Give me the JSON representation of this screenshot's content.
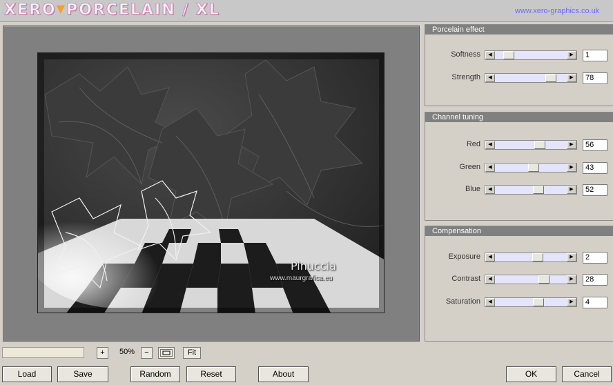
{
  "app": {
    "logo_text_1": "XERO",
    "logo_text_2": "PORCELAIN / XL",
    "url": "www.xero-graphics.co.uk"
  },
  "preview": {
    "artist_signature": "Pinuccia",
    "artist_url": "www.maurgrafica.eu"
  },
  "panels": [
    {
      "title": "Porcelain effect",
      "sliders": [
        {
          "label": "Softness",
          "value": "1",
          "fraction": 0.12
        },
        {
          "label": "Strength",
          "value": "78",
          "fraction": 0.85
        }
      ]
    },
    {
      "title": "Channel tuning",
      "sliders": [
        {
          "label": "Red",
          "value": "56",
          "fraction": 0.66
        },
        {
          "label": "Green",
          "value": "43",
          "fraction": 0.55
        },
        {
          "label": "Blue",
          "value": "52",
          "fraction": 0.63
        }
      ]
    },
    {
      "title": "Compensation",
      "sliders": [
        {
          "label": "Exposure",
          "value": "2",
          "fraction": 0.62
        },
        {
          "label": "Contrast",
          "value": "28",
          "fraction": 0.73
        },
        {
          "label": "Saturation",
          "value": "4",
          "fraction": 0.63
        }
      ]
    }
  ],
  "zoom": {
    "plus": "+",
    "value": "50%",
    "minus": "−",
    "fit": "Fit"
  },
  "buttons": {
    "load": "Load",
    "save": "Save",
    "random": "Random",
    "reset": "Reset",
    "about": "About",
    "ok": "OK",
    "cancel": "Cancel"
  }
}
